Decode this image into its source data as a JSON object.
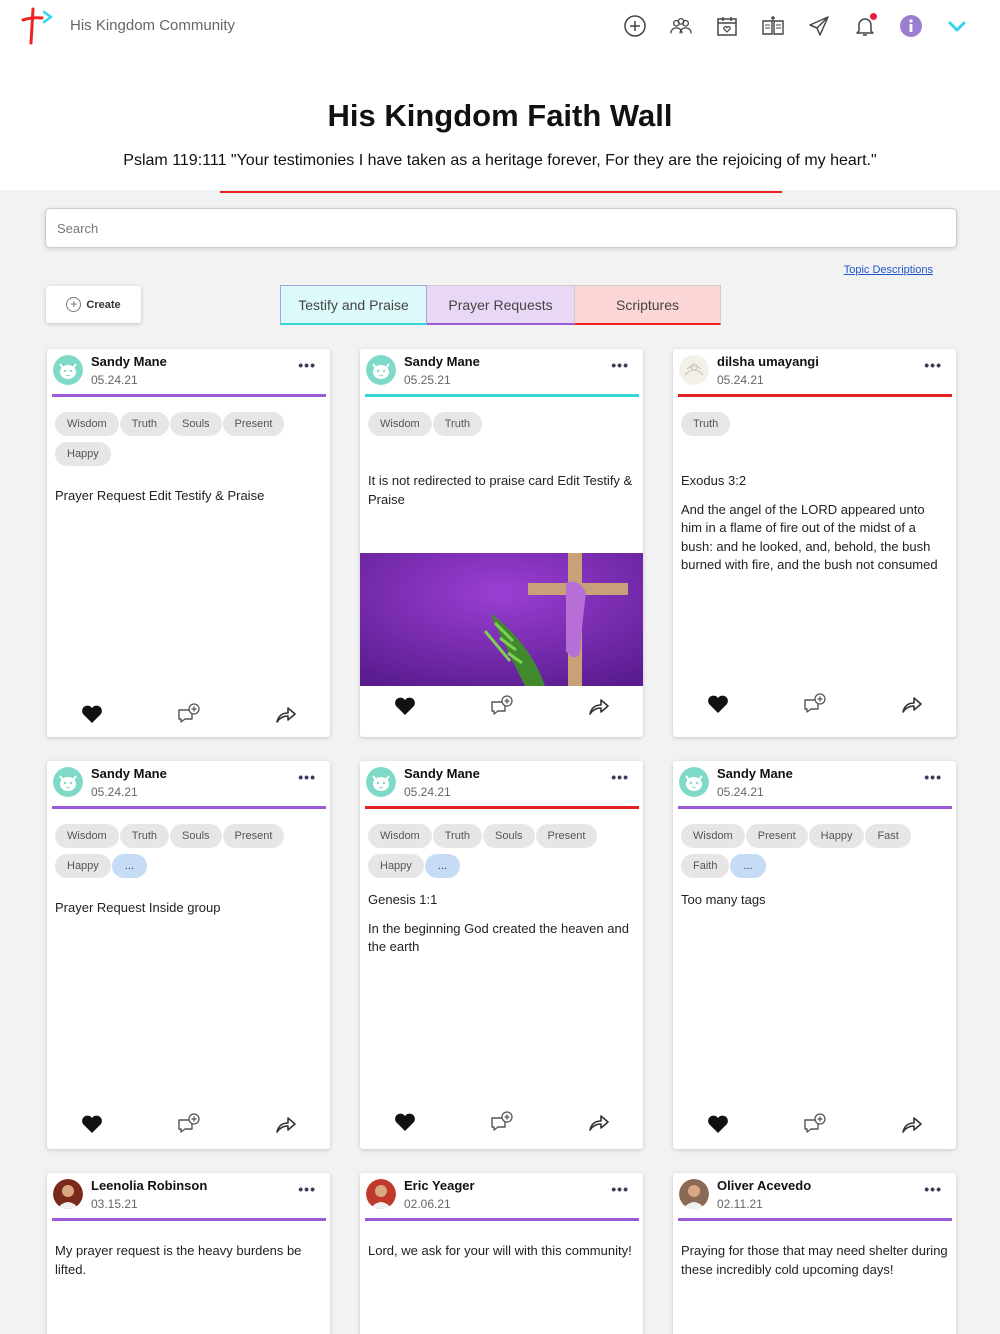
{
  "app": {
    "name": "His Kingdom Community"
  },
  "nav": {
    "icons": [
      "plus-circle-icon",
      "people-icon",
      "calendar-icon",
      "bible-icon",
      "send-icon",
      "bell-icon",
      "info-icon",
      "chevron-down-icon"
    ]
  },
  "hero": {
    "title": "His Kingdom Faith Wall",
    "verse": "Pslam 119:111 \"Your testimonies I have taken as a heritage forever, For they are the rejoicing of my heart.\""
  },
  "search": {
    "placeholder": "Search"
  },
  "topic_link": "Topic Descriptions",
  "create_label": "Create",
  "tabs": [
    {
      "label": "Testify and Praise",
      "color": "#36d6d6"
    },
    {
      "label": "Prayer Requests",
      "color": "#9b5ad8"
    },
    {
      "label": "Scriptures",
      "color": "#e22222"
    }
  ],
  "colors": {
    "testify": "#36d6d6",
    "prayer": "#9b5ad8",
    "scripture": "#e22222",
    "accent": "#2fd5e8"
  },
  "cards": [
    {
      "name": "Sandy Mane",
      "date": "05.24.21",
      "tags": [
        "Wisdom",
        "Truth",
        "Souls",
        "Present",
        "Happy"
      ],
      "heading": "",
      "text": "Prayer Request Edit Testify & Praise"
    },
    {
      "name": "Sandy Mane",
      "date": "05.25.21",
      "tags": [
        "Wisdom",
        "Truth"
      ],
      "heading": "",
      "text": "It is not redirected to praise card Edit Testify & Praise",
      "image": "purple-cross-palm-image"
    },
    {
      "name": "dilsha umayangi",
      "date": "05.24.21",
      "tags": [
        "Truth"
      ],
      "heading": "Exodus 3:2",
      "text": "And the angel of the LORD appeared unto him in a flame of fire out of the midst of a bush: and he looked, and, behold, the bush burned with fire, and the bush not consumed"
    },
    {
      "name": "Sandy Mane",
      "date": "05.24.21",
      "tags": [
        "Wisdom",
        "Truth",
        "Souls",
        "Present",
        "Happy",
        "..."
      ],
      "heading": "",
      "text": "Prayer Request Inside group"
    },
    {
      "name": "Sandy Mane",
      "date": "05.24.21",
      "tags": [
        "Wisdom",
        "Truth",
        "Souls",
        "Present",
        "Happy",
        "..."
      ],
      "heading": "Genesis 1:1",
      "text": "In the beginning God created the heaven and the earth"
    },
    {
      "name": "Sandy Mane",
      "date": "05.24.21",
      "tags": [
        "Wisdom",
        "Present",
        "Happy",
        "Fast",
        "Faith",
        "..."
      ],
      "heading": "",
      "text": "Too many tags"
    },
    {
      "name": "Leenolia Robinson",
      "date": "03.15.21",
      "tags": [],
      "heading": "",
      "text": "My prayer request is the heavy burdens be lifted."
    },
    {
      "name": "Eric Yeager",
      "date": "02.06.21",
      "tags": [],
      "heading": "",
      "text": "Lord, we ask for your will with this community!"
    },
    {
      "name": "Oliver Acevedo",
      "date": "02.11.21",
      "tags": [],
      "heading": "",
      "text": "Praying for those that may need shelter during these incredibly cold upcoming days!"
    }
  ]
}
